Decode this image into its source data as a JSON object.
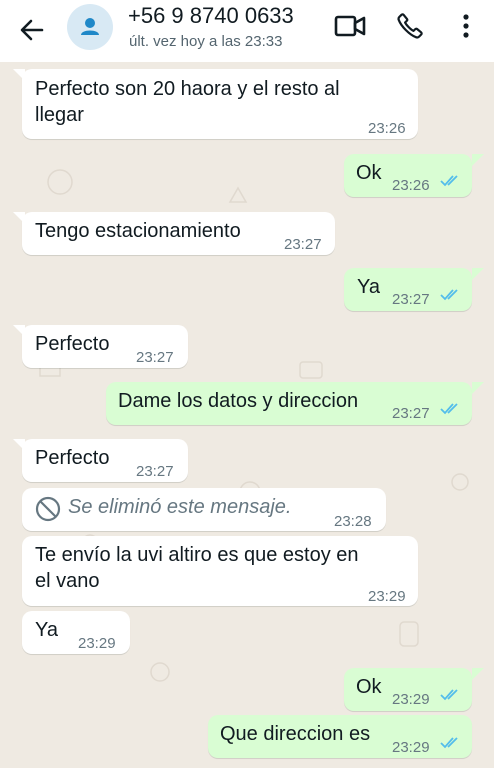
{
  "header": {
    "contact_name": "+56 9 8740 0633",
    "last_seen": "últ. vez hoy a las 23:33",
    "back_icon": "arrow-left-icon",
    "avatar_icon": "person-icon",
    "video_icon": "video-camera-icon",
    "call_icon": "phone-icon",
    "menu_icon": "more-vertical-icon"
  },
  "colors": {
    "header_bg": "#ffffff",
    "chat_bg": "#efeae2",
    "incoming_bubble": "#ffffff",
    "outgoing_bubble": "#d9fdd3",
    "read_ticks": "#53bdeb",
    "timestamp": "#667781"
  },
  "messages": [
    {
      "direction": "in",
      "lines": [
        "Perfecto son 20 haora y el resto al",
        "llegar"
      ],
      "time": "23:26"
    },
    {
      "direction": "out",
      "text": "Ok",
      "time": "23:26",
      "status": "read"
    },
    {
      "direction": "in",
      "text": "Tengo estacionamiento",
      "time": "23:27"
    },
    {
      "direction": "out",
      "text": "Ya",
      "time": "23:27",
      "status": "read"
    },
    {
      "direction": "in",
      "text": "Perfecto",
      "time": "23:27"
    },
    {
      "direction": "out",
      "text": "Dame los datos y direccion",
      "time": "23:27",
      "status": "read"
    },
    {
      "direction": "in",
      "text": "Perfecto",
      "time": "23:27"
    },
    {
      "direction": "in",
      "text": "Se eliminó este mensaje.",
      "time": "23:28",
      "deleted": true,
      "icon": "prohibited-icon"
    },
    {
      "direction": "in",
      "lines": [
        "Te envío la uvi altiro es que estoy en",
        "el vano"
      ],
      "time": "23:29"
    },
    {
      "direction": "in",
      "text": "Ya",
      "time": "23:29"
    },
    {
      "direction": "out",
      "text": "Ok",
      "time": "23:29",
      "status": "read"
    },
    {
      "direction": "out",
      "text": "Que direccion es",
      "time": "23:29",
      "status": "read"
    }
  ]
}
